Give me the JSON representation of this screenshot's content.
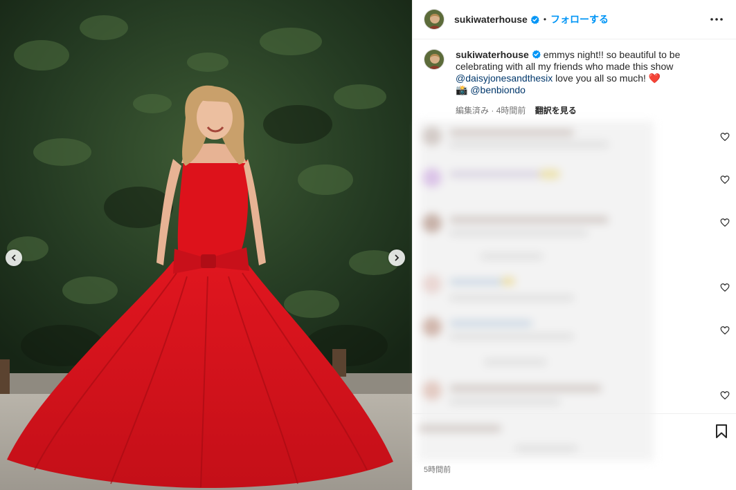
{
  "post": {
    "username": "sukiwaterhouse",
    "verified": true,
    "follow_label": "フォローする",
    "separator": "•"
  },
  "caption": {
    "username": "sukiwaterhouse",
    "text_part1": "emmys night!! so beautiful to be celebrating with all my friends who made this show",
    "mention1": "@daisyjonesandthesix",
    "text_part2": " love you all so much! ",
    "heart_emoji": "❤️",
    "camera_emoji": "📸",
    "mention2": "@benbiondo",
    "edited_label": "編集済み",
    "meta_separator": " · ",
    "time_ago": "4時間前",
    "translate_label": "翻訳を見る"
  },
  "footer": {
    "timestamp": "5時間前"
  },
  "icons": {
    "prev": "chevron-left-icon",
    "next": "chevron-right-icon",
    "more": "more-horizontal-icon",
    "verified": "verified-badge-icon",
    "heart": "heart-outline-icon",
    "bookmark": "bookmark-icon"
  },
  "colors": {
    "accent": "#0095f6",
    "mention": "#00376b",
    "dress_red": "#d9141c"
  }
}
